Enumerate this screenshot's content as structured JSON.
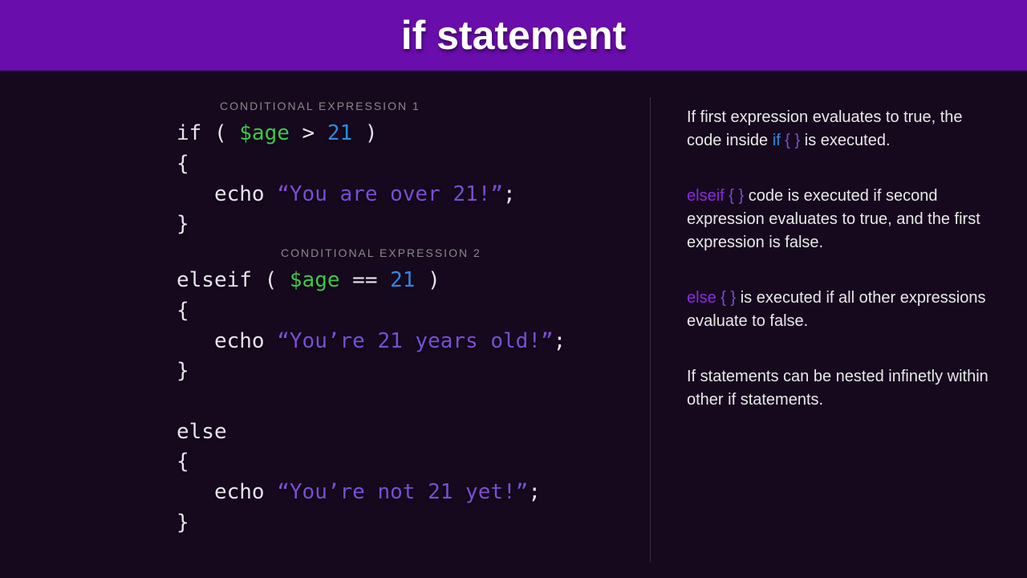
{
  "header": {
    "title": "if statement"
  },
  "labels": {
    "cond1": "CONDITIONAL EXPRESSION 1",
    "cond2": "CONDITIONAL EXPRESSION 2"
  },
  "code": {
    "if_kw": "if",
    "elseif_kw": "elseif",
    "else_kw": "else",
    "open_paren": " ( ",
    "close_paren": " )",
    "var": "$age",
    "gt": " > ",
    "eq": " == ",
    "num": "21",
    "lbrace": "{",
    "rbrace": "}",
    "indent": "   ",
    "echo": "echo",
    "space": " ",
    "str1": "“You are over 21!”",
    "str2": "“You’re 21 years old!”",
    "str3": "“You’re not 21 yet!”",
    "semi": ";"
  },
  "side": {
    "p1a": "If first expression evaluates to true, the code inside ",
    "p1kw": "if",
    "p1braces": " { } ",
    "p1b": "is executed.",
    "p2kw": "elseif",
    "p2braces": " { } ",
    "p2b": "code is executed if second expression evaluates to true, and the first expression is false.",
    "p3kw": "else",
    "p3braces": " { } ",
    "p3b": "is executed if all other expressions evaluate to false.",
    "p4": "If statements can be nested infinetly within other if statements."
  }
}
